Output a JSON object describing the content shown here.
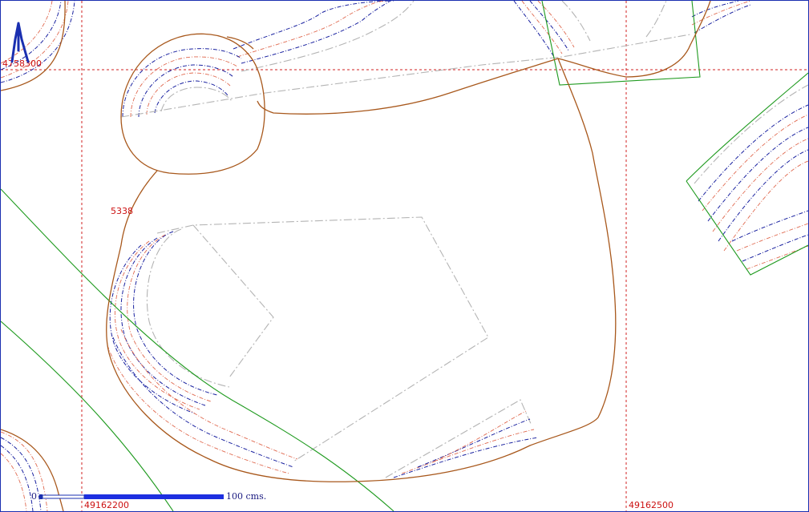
{
  "map": {
    "coord_y_top": "4758300",
    "coord_x_left": "49162200",
    "coord_x_right": "49162500",
    "parcel_label": "5338",
    "scale_zero": "0",
    "scale_label": "100 cms."
  },
  "colors": {
    "grid": "#d02020",
    "parcel_boundary": "#a8581c",
    "road_edge": "#1e9a1e",
    "building": "#b4b4b4",
    "contour_blue": "#1a22a0",
    "contour_red": "#e06a50",
    "north_arrow": "#1a2fb0"
  },
  "icons": {
    "north_arrow": "north-arrow-icon",
    "scale_bar": "scale-bar"
  }
}
